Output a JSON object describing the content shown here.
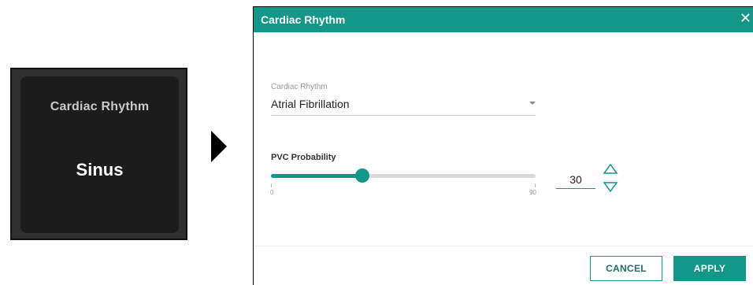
{
  "tile": {
    "title": "Cardiac Rhythm",
    "value": "Sinus"
  },
  "dialog": {
    "title": "Cardiac Rhythm",
    "close_icon": "close-icon",
    "rhythm_field": {
      "label": "Cardiac Rhythm",
      "selected": "Atrial Fibrillation"
    },
    "pvc": {
      "label": "PVC Probability",
      "min_label": "0",
      "max_label": "90",
      "value": 30,
      "value_text": "30",
      "min": 0,
      "max": 90
    },
    "buttons": {
      "cancel_label": "CANCEL",
      "apply_label": "APPLY"
    }
  },
  "colors": {
    "accent": "#13978a",
    "tile_bg": "#1c1c1c"
  }
}
